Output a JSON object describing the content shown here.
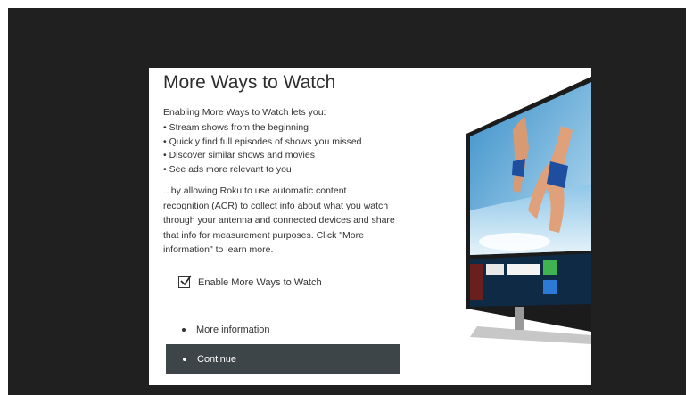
{
  "dialog": {
    "title": "More Ways to Watch",
    "intro": "Enabling More Ways to Watch lets you:",
    "bullets": [
      "Stream shows from the beginning",
      "Quickly find full episodes of shows you missed",
      "Discover similar shows and movies",
      "See ads more relevant to you"
    ],
    "acr_lines": [
      "...by allowing Roku to use automatic content",
      "recognition (ACR) to collect info about what you watch",
      "through your antenna and connected devices and share",
      "that info for measurement purposes. Click \"More",
      "information\" to learn more."
    ],
    "checkbox_label": "Enable More Ways to Watch",
    "checkbox_checked": true,
    "more_info_label": "More information",
    "continue_label": "Continue"
  },
  "colors": {
    "screen_bg": "#202020",
    "dialog_bg": "#ffffff",
    "button_bg": "#3e4548",
    "tv_hulu": "#3fb34f",
    "tv_vudu": "#2c7ad6"
  },
  "icons": [
    "checkmark-icon",
    "bullet-icon",
    "tv-illustration"
  ]
}
